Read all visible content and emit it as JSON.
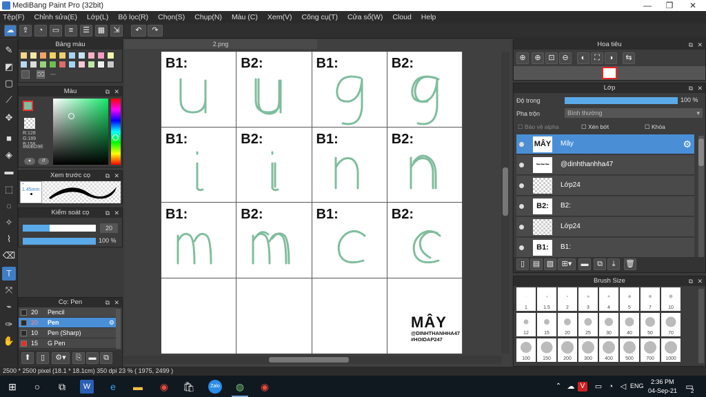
{
  "window": {
    "title": "MediBang Paint Pro (32bit)"
  },
  "menu": [
    "Tệp(F)",
    "Chỉnh sửa(E)",
    "Lớp(L)",
    "Bộ lọc(R)",
    "Chọn(S)",
    "Chụp(N)",
    "Màu (C)",
    "Xem(V)",
    "Công cụ(T)",
    "Cửa sổ(W)",
    "Cloud",
    "Help"
  ],
  "panels": {
    "palette": {
      "title": "Bảng màu",
      "dash": "---",
      "colors": [
        "#f5d88a",
        "#f7e7a6",
        "#f3a36b",
        "#f4d35e",
        "#f0d070",
        "#a9d2f5",
        "#c7e4f7",
        "#f6b2c6",
        "#f19ec0",
        "#f5f5b0",
        "#b9d9f2",
        "#dcdcdc",
        "#9bd17d",
        "#6dbf52",
        "#e06a6a",
        "#a2d6f0",
        "#f4c8d6",
        "#bde8a5",
        "#f0f0f0",
        "#c9c9c9"
      ]
    },
    "color": {
      "title": "Màu",
      "r": "R:128",
      "g": "G:189",
      "b": "B:158",
      "hex": "#80BD9E"
    },
    "brush_preview": {
      "title": "Xem trước cọ",
      "size": "* 1.45mm"
    },
    "brush_control": {
      "title": "Kiểm soát cọ",
      "size": "20",
      "opacity": "100 %",
      "size_frac": 0.37,
      "opacity_frac": 1.0
    },
    "brushes": {
      "title": "Cọ: Pen",
      "items": [
        {
          "size": "20",
          "name": "Pencil",
          "color": "#2b2b2b"
        },
        {
          "size": "20",
          "name": "Pen",
          "color": "#2b2b2b"
        },
        {
          "size": "10",
          "name": "Pen (Sharp)",
          "color": "#2b2b2b"
        },
        {
          "size": "15",
          "name": "G Pen",
          "color": "#e03030"
        }
      ]
    },
    "navigator": {
      "title": "Hoa tiêu"
    },
    "layers": {
      "title": "Lớp",
      "opacity_label": "Độ trong",
      "opacity_value": "100 %",
      "blend_label": "Pha trộn",
      "blend_value": "Bình thường",
      "protect_alpha": "Bảo vệ alpha",
      "clipping": "Xén bớt",
      "lock": "Khóa",
      "items": [
        {
          "name": "Mây",
          "thumb": "MÂY"
        },
        {
          "name": "@dinhthanhha47",
          "thumb": "~~~"
        },
        {
          "name": "Lớp24",
          "thumb": ""
        },
        {
          "name": "B2:",
          "thumb": "B2:"
        },
        {
          "name": "Lớp24",
          "thumb": ""
        },
        {
          "name": "B1:",
          "thumb": "B1:"
        }
      ]
    },
    "brush_size": {
      "title": "Brush Size",
      "sizes": [
        "1",
        "1.5",
        "2",
        "3",
        "4",
        "5",
        "7",
        "10",
        "12",
        "15",
        "20",
        "25",
        "30",
        "40",
        "50",
        "70",
        "100",
        "150",
        "200",
        "300",
        "400",
        "500",
        "700",
        "1000"
      ]
    }
  },
  "document": {
    "tab": "2.png",
    "cells": [
      {
        "label": "B1:",
        "letter": "u"
      },
      {
        "label": "B2:",
        "letter": "u"
      },
      {
        "label": "B1:",
        "letter": "g"
      },
      {
        "label": "B2:",
        "letter": "g"
      },
      {
        "label": "B1:",
        "letter": "i"
      },
      {
        "label": "B2:",
        "letter": "i"
      },
      {
        "label": "B1:",
        "letter": "n"
      },
      {
        "label": "B2:",
        "letter": "n"
      },
      {
        "label": "B1:",
        "letter": "m"
      },
      {
        "label": "B2:",
        "letter": "m"
      },
      {
        "label": "B1:",
        "letter": "c"
      },
      {
        "label": "B2:",
        "letter": "c"
      }
    ],
    "signature": {
      "name": "MÂY",
      "handle": "@DINHTHANHHA47",
      "tag": "#HOIDAP247"
    },
    "stroke_color": "#80BD9E"
  },
  "status": "2500 * 2500 pixel  (18.1 * 18.1cm)  350 dpi  23 %  ( 1975, 2499 )",
  "taskbar": {
    "lang": "ENG",
    "time": "2:36 PM",
    "date": "04-Sep-21",
    "badge": "2"
  }
}
